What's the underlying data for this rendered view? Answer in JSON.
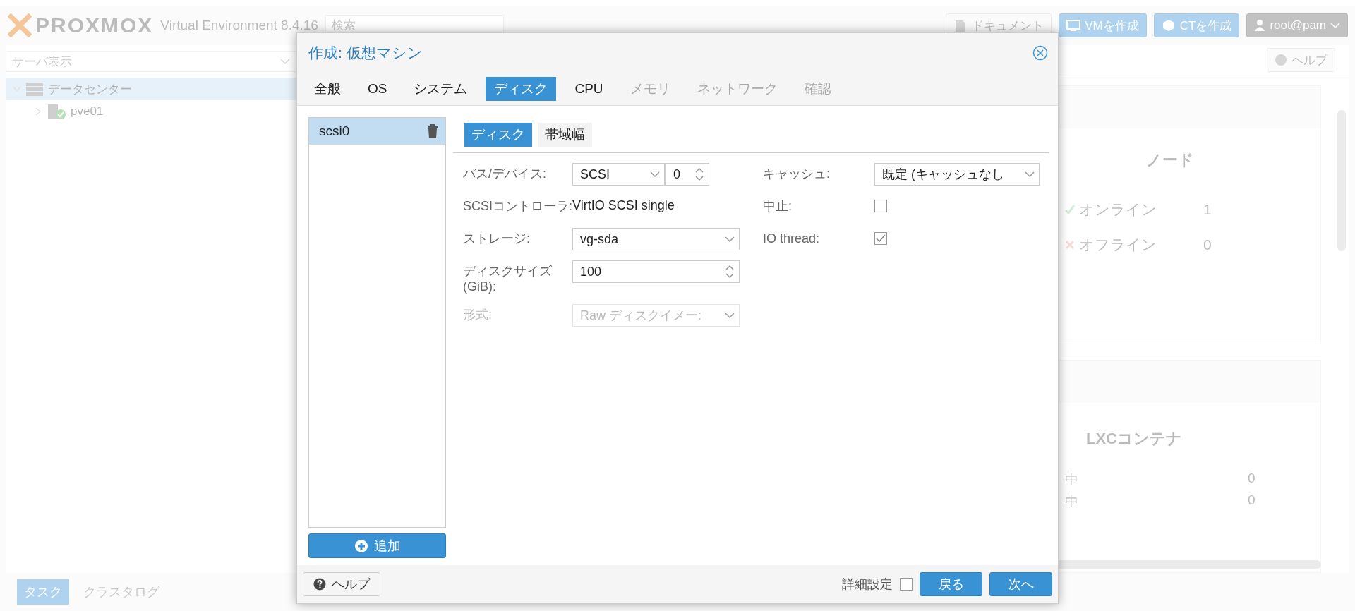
{
  "header": {
    "logo": "PROXMOX",
    "version": "Virtual Environment 8.4.16",
    "search": {
      "placeholder": "検索"
    },
    "buttons": [
      {
        "label": "ドキュメント",
        "kind": "docs"
      },
      {
        "label": "VMを作成",
        "kind": "vm"
      },
      {
        "label": "CTを作成",
        "kind": "ct"
      }
    ],
    "user": "root@pam"
  },
  "tree": {
    "view": {
      "placeholder": "サーバ表示"
    },
    "items": [
      {
        "label": "データセンター",
        "kind": "datacenter",
        "selected": true,
        "expanded": true,
        "children": [
          {
            "label": "pve01",
            "kind": "node",
            "selected": false,
            "expanded": false
          }
        ]
      }
    ]
  },
  "toolbar": {
    "help_button": "ヘルプ"
  },
  "dashboard": {
    "nodes": {
      "title": "ノード",
      "rows": [
        {
          "label": "オンライン",
          "value": "1",
          "kind": "online"
        },
        {
          "label": "オフライン",
          "value": "0",
          "kind": "offline"
        }
      ]
    },
    "containers": {
      "title": "LXCコンテナ",
      "rows": [
        {
          "label": "中",
          "value": "0"
        },
        {
          "label": "中",
          "value": "0"
        }
      ]
    }
  },
  "bottom_tabs": [
    {
      "label": "タスク",
      "selected": true
    },
    {
      "label": "クラスタログ",
      "selected": false
    }
  ],
  "dialog": {
    "title": "作成: 仮想マシン",
    "tabs": [
      {
        "label": "全般",
        "selected": false,
        "disabled": false
      },
      {
        "label": "OS",
        "selected": false,
        "disabled": false
      },
      {
        "label": "システム",
        "selected": false,
        "disabled": false
      },
      {
        "label": "ディスク",
        "selected": true,
        "disabled": false
      },
      {
        "label": "CPU",
        "selected": false,
        "disabled": false
      },
      {
        "label": "メモリ",
        "selected": false,
        "disabled": true
      },
      {
        "label": "ネットワーク",
        "selected": false,
        "disabled": true
      },
      {
        "label": "確認",
        "selected": false,
        "disabled": true
      }
    ],
    "disks": [
      {
        "label": "scsi0",
        "selected": true
      }
    ],
    "add_button": "追加",
    "subtabs": [
      {
        "label": "ディスク",
        "selected": true
      },
      {
        "label": "帯域幅",
        "selected": false
      }
    ],
    "left_fields": [
      {
        "label": "バス/デバイス:",
        "kind": "select-spin",
        "value": "SCSI",
        "value2": "0",
        "disabled": false
      },
      {
        "label": "SCSIコントローラ:",
        "kind": "text",
        "value": "VirtIO SCSI single"
      },
      {
        "label": "ストレージ:",
        "kind": "select",
        "value": "vg-sda",
        "disabled": false
      },
      {
        "label": "ディスクサイズ (GiB):",
        "kind": "spin",
        "value": "100",
        "disabled": false
      },
      {
        "label": "形式:",
        "kind": "select",
        "value": "Raw ディスクイメー:",
        "disabled": true
      }
    ],
    "right_fields": [
      {
        "label": "キャッシュ:",
        "kind": "select",
        "value": "既定 (キャッシュなし",
        "disabled": false
      },
      {
        "label": "中止:",
        "kind": "checkbox",
        "checked": false,
        "disabled": false
      },
      {
        "label": "IO thread:",
        "kind": "checkbox",
        "checked": true,
        "disabled": false
      }
    ],
    "footer": {
      "help_button": "ヘルプ",
      "advanced": {
        "label": "詳細設定",
        "checked": false
      },
      "back_button": "戻る",
      "next_button": "次へ"
    }
  }
}
